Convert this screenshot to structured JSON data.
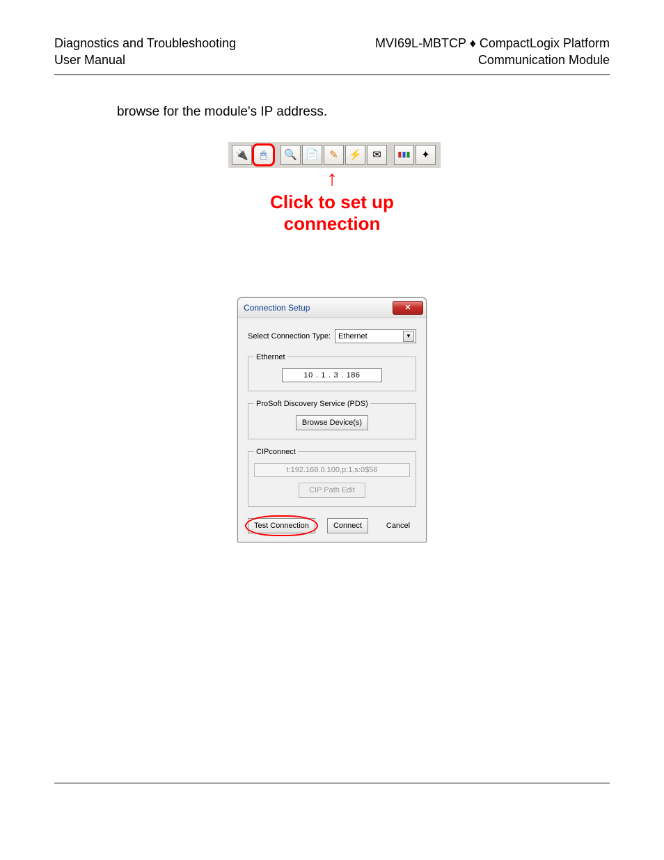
{
  "header": {
    "left_line1": "Diagnostics and Troubleshooting",
    "left_line2": "User Manual",
    "right_line1": "MVI69L-MBTCP ♦ CompactLogix Platform",
    "right_line2": "Communication Module"
  },
  "body": {
    "intro_text": "browse for the module's IP address."
  },
  "annotation": {
    "text": "Click to set up connection"
  },
  "toolbar_icons": [
    {
      "name": "connect-icon",
      "glyph": "🔌"
    },
    {
      "name": "setup-connection-icon",
      "glyph": "🕹",
      "highlight": true
    },
    {
      "name": "refresh-icon",
      "glyph": "↻"
    },
    {
      "name": "document-icon",
      "glyph": "📄"
    },
    {
      "name": "edit-icon",
      "glyph": "✎"
    },
    {
      "name": "transfer-icon",
      "glyph": "⇆"
    },
    {
      "name": "send-icon",
      "glyph": "✉"
    },
    {
      "name": "chart-icon",
      "glyph": "▮▮▮"
    },
    {
      "name": "tools-icon",
      "glyph": "✦"
    }
  ],
  "dialog": {
    "title": "Connection Setup",
    "close_label": "✕",
    "connection_type_label": "Select Connection Type:",
    "connection_type_value": "Ethernet",
    "ethernet_legend": "Ethernet",
    "ip_octets": [
      "10",
      "1",
      "3",
      "186"
    ],
    "pds_legend": "ProSoft Discovery Service (PDS)",
    "browse_label": "Browse Device(s)",
    "cip_legend": "CIPconnect",
    "cip_path_value": "t:192.168.0.100,p:1,s:0$56",
    "cip_edit_label": "CIP Path Edit",
    "test_label": "Test Connection",
    "connect_label": "Connect",
    "cancel_label": "Cancel"
  }
}
